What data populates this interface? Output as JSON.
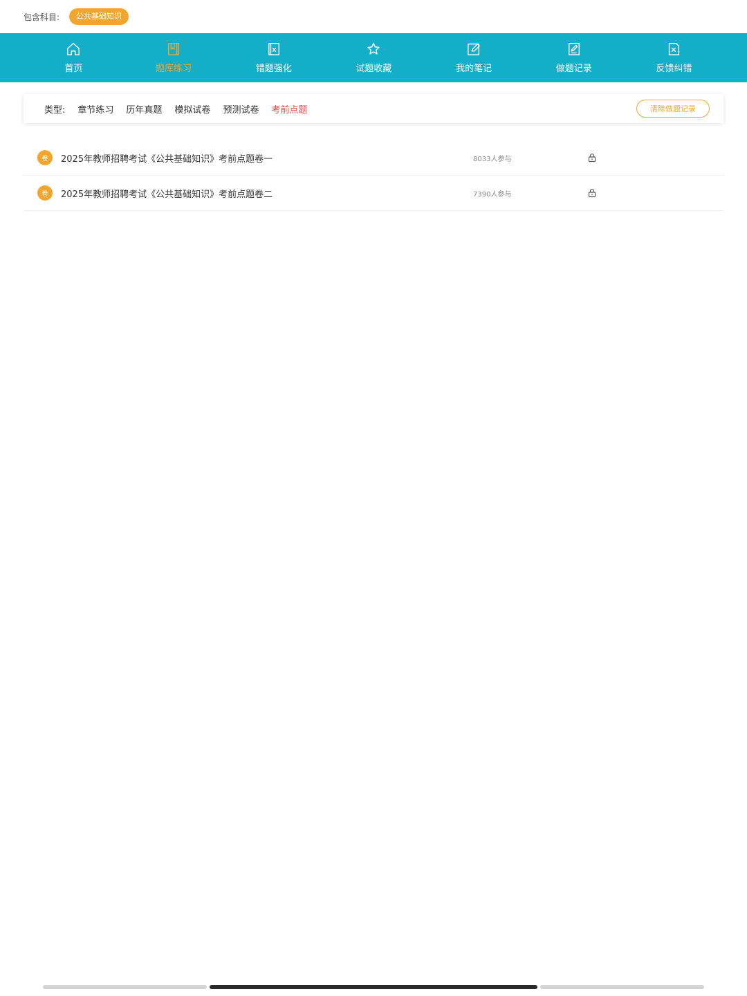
{
  "subject": {
    "label": "包含科目:",
    "chip": "公共基础知识"
  },
  "nav": {
    "items": [
      {
        "label": "首页",
        "icon": "home-icon"
      },
      {
        "label": "题库练习",
        "icon": "book-icon",
        "active": true
      },
      {
        "label": "错题强化",
        "icon": "error-book-icon"
      },
      {
        "label": "试题收藏",
        "icon": "star-icon"
      },
      {
        "label": "我的笔记",
        "icon": "edit-icon"
      },
      {
        "label": "做题记录",
        "icon": "record-icon"
      },
      {
        "label": "反馈纠错",
        "icon": "feedback-icon"
      }
    ],
    "active_color": "#f1a62f",
    "bg_color": "#13aec8"
  },
  "filter": {
    "label": "类型:",
    "tabs": [
      {
        "label": "章节练习"
      },
      {
        "label": "历年真题"
      },
      {
        "label": "模拟试卷"
      },
      {
        "label": "预测试卷"
      },
      {
        "label": "考前点题",
        "active": true
      }
    ],
    "clear_label": "清除做题记录",
    "active_color": "#e0484b"
  },
  "papers": [
    {
      "badge": "卷",
      "title": "2025年教师招聘考试《公共基础知识》考前点题卷一",
      "count": "8033人参与",
      "icon": "lock-icon"
    },
    {
      "badge": "卷",
      "title": "2025年教师招聘考试《公共基础知识》考前点题卷二",
      "count": "7390人参与",
      "icon": "lock-icon"
    }
  ]
}
